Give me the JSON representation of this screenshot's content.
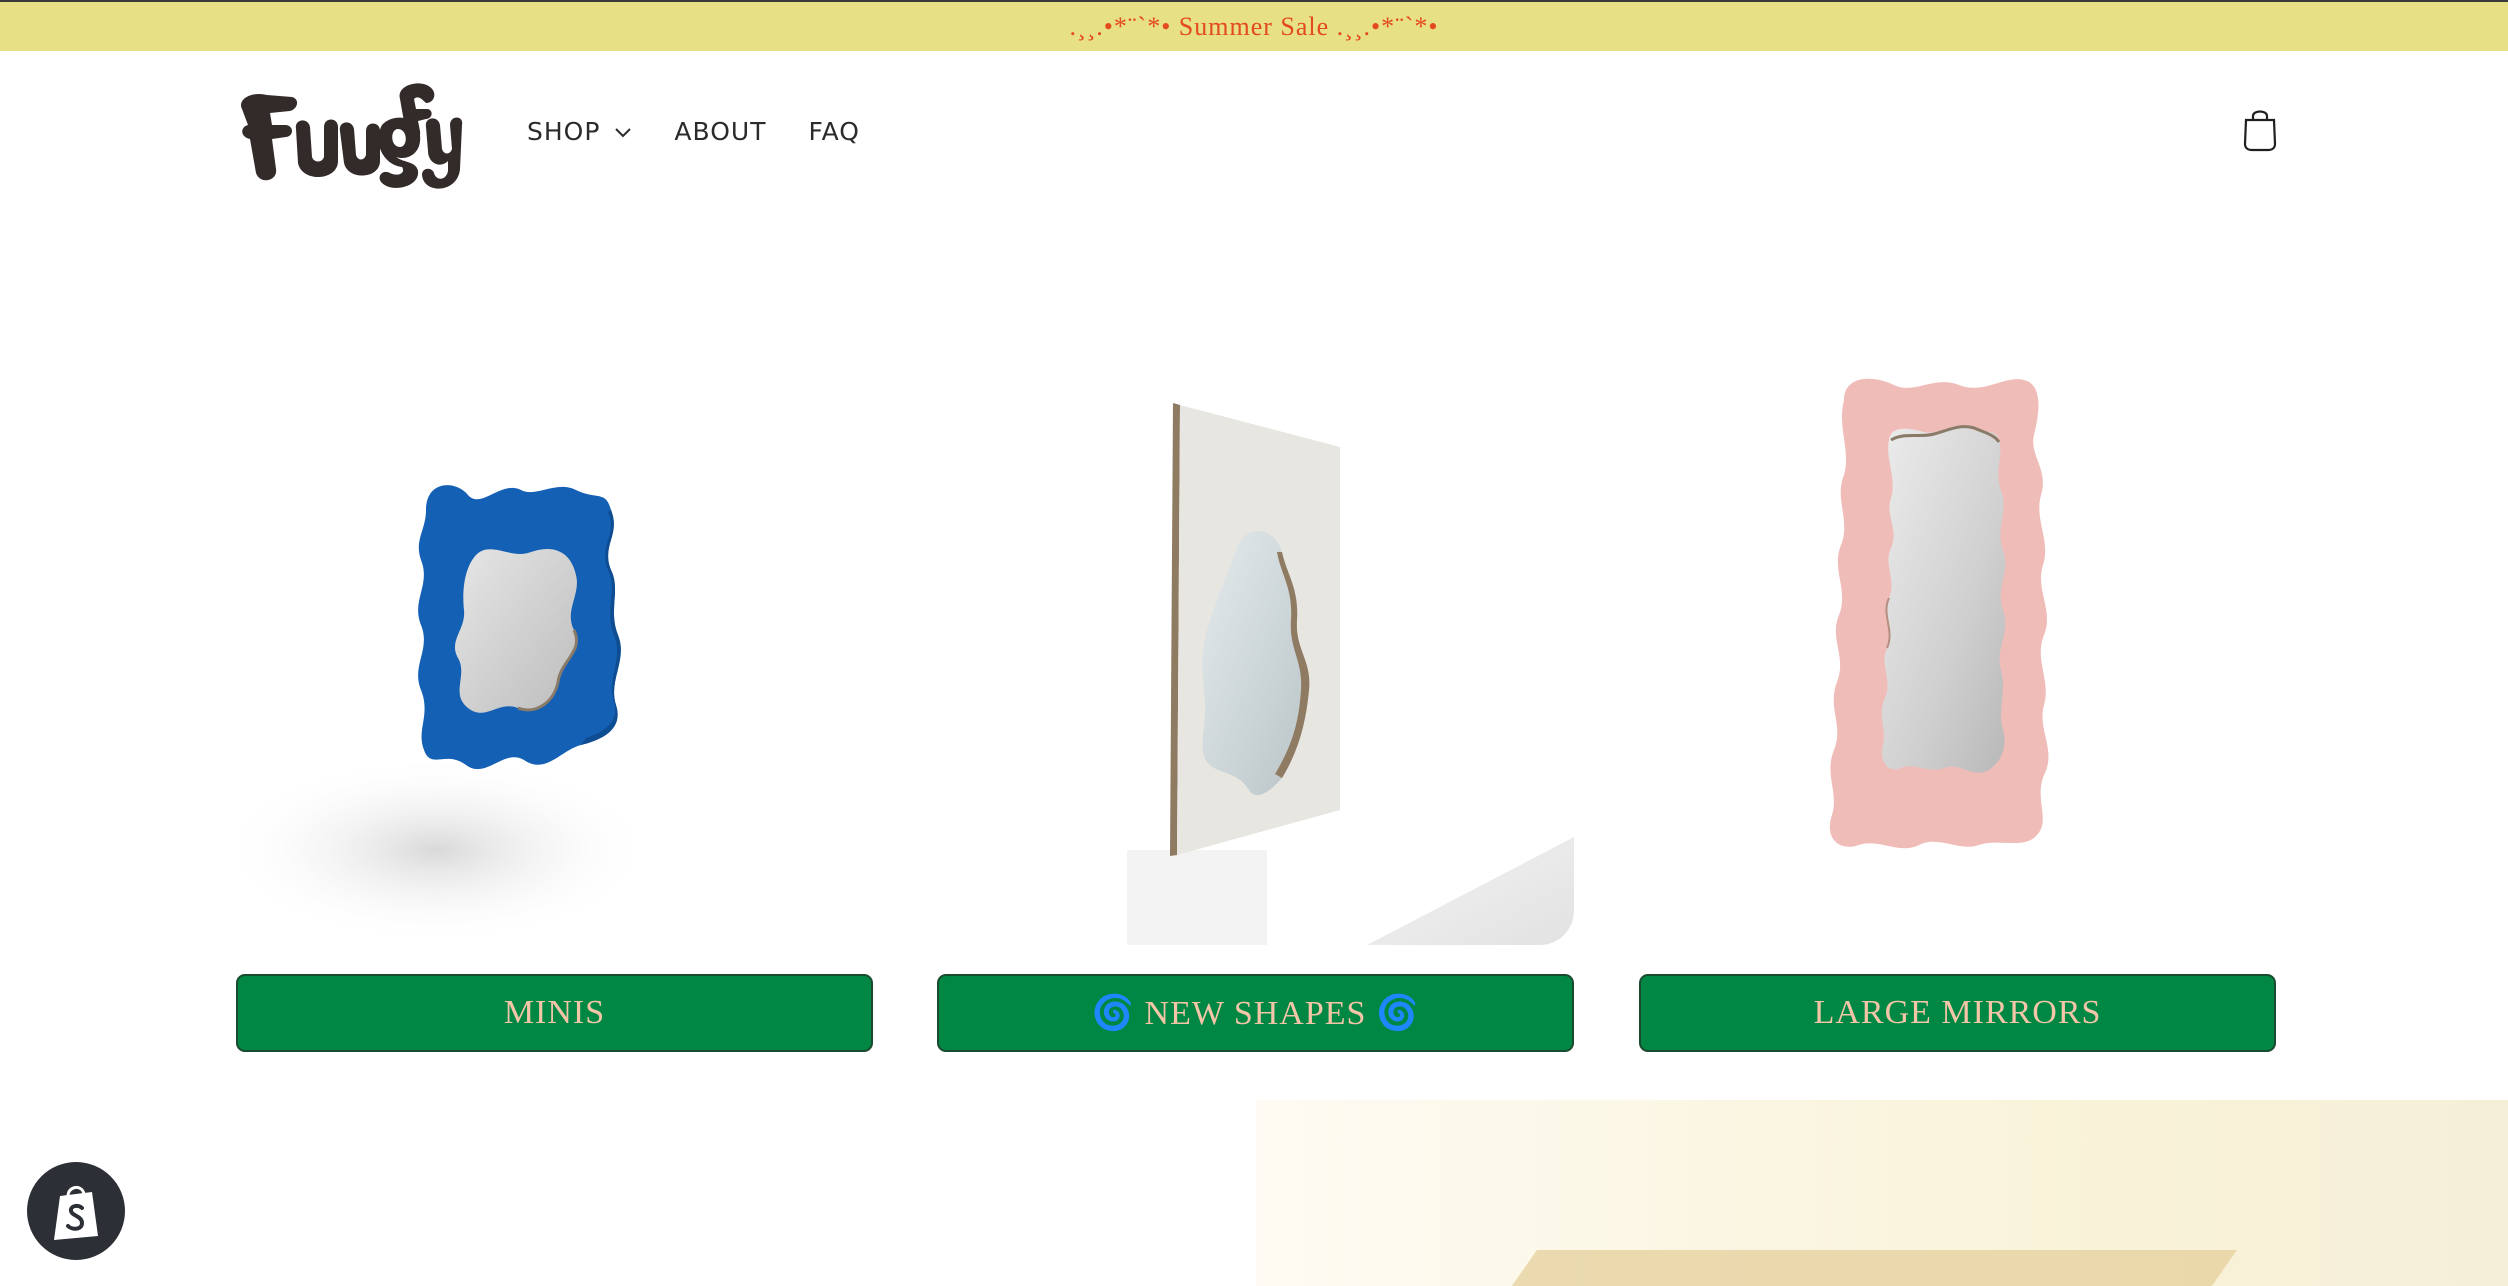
{
  "announcement": {
    "text": ".¸¸.•*¨`*• Summer Sale .¸¸.•*¨`*•",
    "color": "#e34a1c",
    "background": "#e8e085"
  },
  "header": {
    "logo_name": "Fuugly logo",
    "nav": [
      {
        "label": "SHOP",
        "has_dropdown": true
      },
      {
        "label": "ABOUT"
      },
      {
        "label": "FAQ"
      }
    ],
    "cart_icon": "shopping-bag-icon"
  },
  "collections": [
    {
      "label": "MINIS",
      "frame_color": "#1460b4"
    },
    {
      "label": "🌀 NEW SHAPES 🌀",
      "frame_color": "#e8e6e1"
    },
    {
      "label": "LARGE MIRRORS",
      "frame_color": "#f0bcb8"
    }
  ],
  "colors": {
    "button_bg": "#008744",
    "button_text": "#f4c6a8"
  },
  "shopify_badge_icon": "shopify-bag-icon"
}
